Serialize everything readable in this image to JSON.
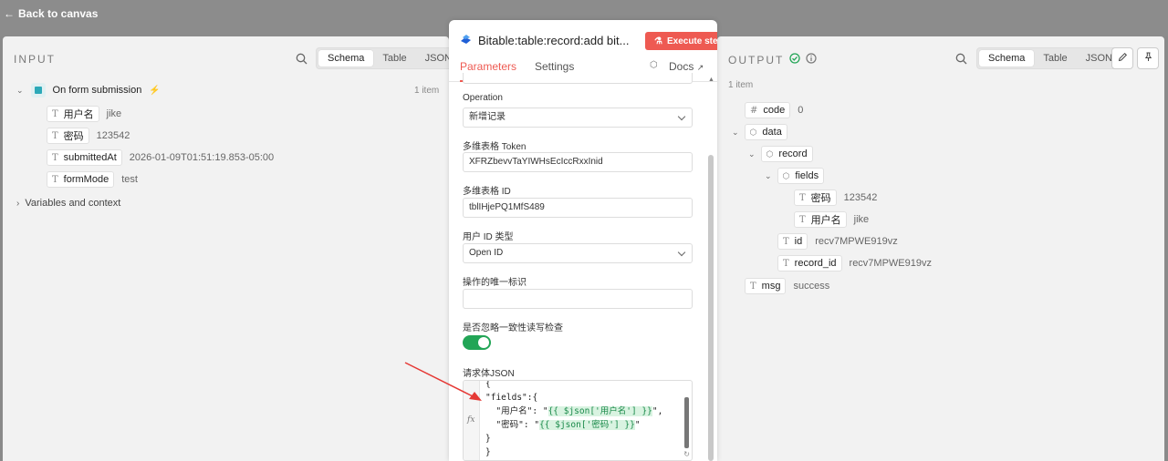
{
  "topbar": {
    "back_label": "Back to canvas"
  },
  "input": {
    "title": "INPUT",
    "tabs": [
      "Schema",
      "Table",
      "JSON"
    ],
    "node_name": "On form submission",
    "item_count": "1 item",
    "fields": [
      {
        "key": "用户名",
        "value": "jike"
      },
      {
        "key": "密码",
        "value": "123542"
      },
      {
        "key": "submittedAt",
        "value": "2026-01-09T01:51:19.853-05:00"
      },
      {
        "key": "formMode",
        "value": "test"
      }
    ],
    "variables_label": "Variables and context"
  },
  "center": {
    "title": "Bitable:table:record:add bit...",
    "execute_label": "Execute step",
    "tabs": {
      "parameters": "Parameters",
      "settings": "Settings",
      "docs": "Docs"
    },
    "operation_label": "Operation",
    "operation_value": "新增记录",
    "token_label": "多维表格 Token",
    "token_value": "XFRZbevvTaYIWHsEcIccRxxInid",
    "table_id_label": "多维表格 ID",
    "table_id_value": "tblIHjePQ1MfS489",
    "user_id_type_label": "用户 ID 类型",
    "user_id_type_value": "Open ID",
    "unique_id_label": "操作的唯一标识",
    "unique_id_value": "",
    "ignore_consistency_label": "是否忽略一致性读写检查",
    "body_label": "请求体JSON",
    "code_lines": {
      "l0": "{",
      "l1": "\"fields\":{",
      "l2a": "\"用户名\": \"",
      "l2b": "{{ $json['用户名'] }}",
      "l2c": "\",",
      "l3a": "\"密码\": \"",
      "l3b": "{{ $json['密码'] }}",
      "l3c": "\"",
      "l4": "}",
      "l5": "}"
    }
  },
  "output": {
    "title": "OUTPUT",
    "tabs": [
      "Schema",
      "Table",
      "JSON"
    ],
    "item_count": "1 item",
    "code": {
      "key": "code",
      "value": "0"
    },
    "data_key": "data",
    "record_key": "record",
    "fields_key": "fields",
    "fields": [
      {
        "key": "密码",
        "value": "123542"
      },
      {
        "key": "用户名",
        "value": "jike"
      }
    ],
    "id": {
      "key": "id",
      "value": "recv7MPWE919vz"
    },
    "record_id": {
      "key": "record_id",
      "value": "recv7MPWE919vz"
    },
    "msg": {
      "key": "msg",
      "value": "success"
    }
  },
  "colors": {
    "accent": "#ee5a52",
    "toggle_on": "#22a556",
    "success": "#22a556"
  }
}
